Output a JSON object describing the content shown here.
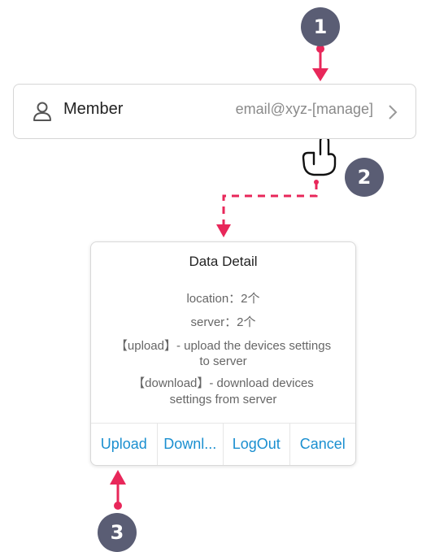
{
  "steps": [
    "1",
    "2",
    "3"
  ],
  "member": {
    "label": "Member",
    "value": "email@xyz-[manage]",
    "icon": "user-icon",
    "chevron_icon": "chevron-right-icon"
  },
  "dialog": {
    "title": "Data Detail",
    "location": "location：2个",
    "server": "server：2个",
    "upload_desc_1": "【upload】- upload the devices settings",
    "upload_desc_2": "to server",
    "download_desc_1": "【download】- download devices",
    "download_desc_2": "settings from server",
    "actions": [
      "Upload",
      "Downl...",
      "LogOut",
      "Cancel"
    ]
  },
  "colors": {
    "badge": "#5a5d74",
    "arrow": "#e8275a",
    "action_text": "#1a8fd0"
  },
  "icons": {
    "tap_hand": "tap-hand-icon"
  }
}
